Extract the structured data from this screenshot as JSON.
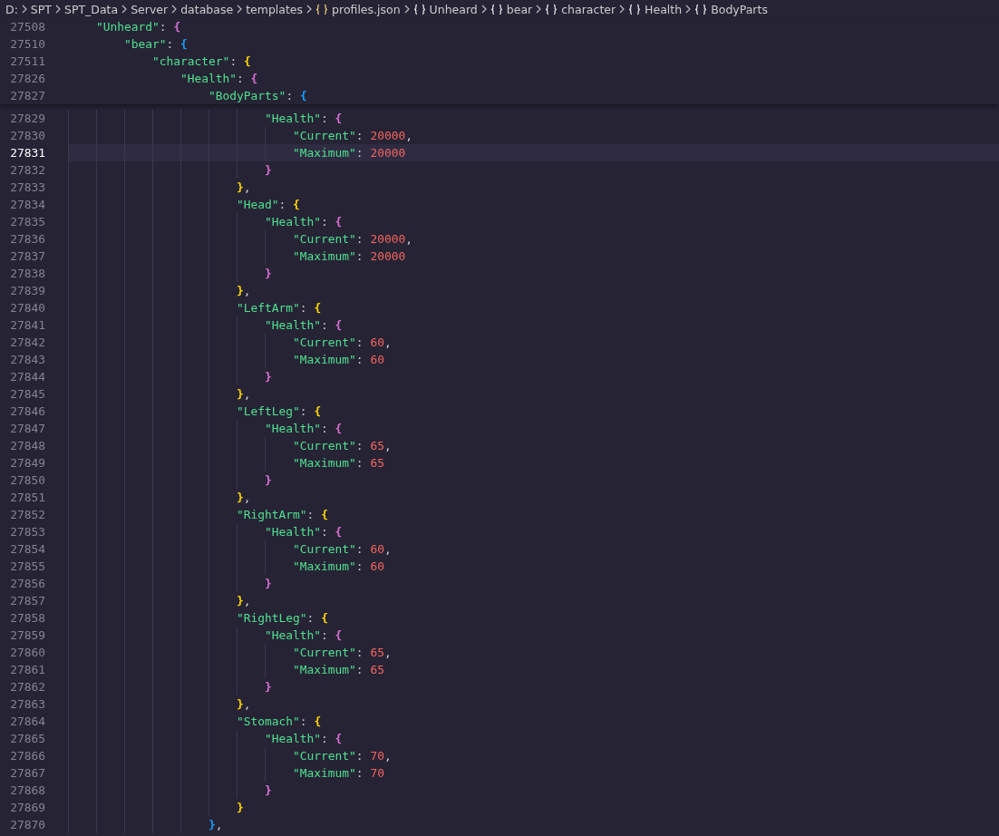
{
  "breadcrumbs": [
    {
      "label": "D:",
      "kind": "folder"
    },
    {
      "label": "SPT",
      "kind": "folder"
    },
    {
      "label": "SPT_Data",
      "kind": "folder"
    },
    {
      "label": "Server",
      "kind": "folder"
    },
    {
      "label": "database",
      "kind": "folder"
    },
    {
      "label": "templates",
      "kind": "folder"
    },
    {
      "label": "profiles.json",
      "kind": "json-file"
    },
    {
      "label": "Unheard",
      "kind": "object"
    },
    {
      "label": "bear",
      "kind": "object"
    },
    {
      "label": "character",
      "kind": "object"
    },
    {
      "label": "Health",
      "kind": "object"
    },
    {
      "label": "BodyParts",
      "kind": "object"
    }
  ],
  "sticky_scroll": [
    {
      "number": "27508",
      "tokens": [
        {
          "kind": "key",
          "text": "\"Unheard\""
        },
        {
          "kind": "punct",
          "text": ":"
        },
        {
          "kind": "bracket",
          "text": "{",
          "color": "#da70d6"
        }
      ],
      "children": [
        {
          "number": "27510",
          "tokens": [
            {
              "kind": "key",
              "text": "\"bear\""
            },
            {
              "kind": "punct",
              "text": ":"
            },
            {
              "kind": "bracket",
              "text": "{",
              "color": "#179fff"
            }
          ],
          "children": [
            {
              "number": "27511",
              "tokens": [
                {
                  "kind": "key",
                  "text": "\"character\""
                },
                {
                  "kind": "punct",
                  "text": ":"
                },
                {
                  "kind": "bracket",
                  "text": "{",
                  "color": "#ffd700"
                }
              ],
              "children": [
                {
                  "number": "27826",
                  "tokens": [
                    {
                      "kind": "key",
                      "text": "\"Health\""
                    },
                    {
                      "kind": "punct",
                      "text": ":"
                    },
                    {
                      "kind": "bracket",
                      "text": "{",
                      "color": "#da70d6"
                    }
                  ],
                  "children": [
                    {
                      "number": "27827",
                      "tokens": [
                        {
                          "kind": "key",
                          "text": "\"BodyParts\""
                        },
                        {
                          "kind": "punct",
                          "text": ":"
                        },
                        {
                          "kind": "bracket",
                          "text": "{",
                          "color": "#179fff"
                        }
                      ]
                    }
                  ]
                }
              ]
            }
          ]
        }
      ]
    }
  ],
  "lines": [
    {
      "children": [
        {
          "children": [
            {
              "number": "27829",
              "current": false,
              "tokens": [
                {
                  "kind": "key",
                  "text": "\"Health\""
                },
                {
                  "kind": "punct",
                  "text": ":"
                },
                {
                  "kind": "bracket",
                  "text": "{",
                  "color": "#da70d6"
                }
              ],
              "children": [
                {
                  "number": "27830",
                  "current": false,
                  "tokens": [
                    {
                      "kind": "key",
                      "text": "\"Current\""
                    },
                    {
                      "kind": "punct",
                      "text": ":"
                    },
                    {
                      "kind": "number",
                      "text": "20000"
                    },
                    {
                      "kind": "comma",
                      "text": ","
                    }
                  ]
                },
                {
                  "number": "27831",
                  "current": true,
                  "tokens": [
                    {
                      "kind": "key",
                      "text": "\"Maximum\""
                    },
                    {
                      "kind": "punct",
                      "text": ":"
                    },
                    {
                      "kind": "number",
                      "text": "20000"
                    }
                  ]
                }
              ]
            },
            {
              "number": "27832",
              "current": false,
              "tokens": [
                {
                  "kind": "bracket",
                  "text": "}",
                  "color": "#da70d6"
                }
              ]
            }
          ]
        },
        {
          "number": "27833",
          "current": false,
          "tokens": [
            {
              "kind": "bracket",
              "text": "}",
              "color": "#ffd700"
            },
            {
              "kind": "comma",
              "text": ","
            }
          ]
        },
        {
          "number": "27834",
          "current": false,
          "tokens": [
            {
              "kind": "key",
              "text": "\"Head\""
            },
            {
              "kind": "punct",
              "text": ":"
            },
            {
              "kind": "bracket",
              "text": "{",
              "color": "#ffd700"
            }
          ],
          "children": [
            {
              "number": "27835",
              "current": false,
              "tokens": [
                {
                  "kind": "key",
                  "text": "\"Health\""
                },
                {
                  "kind": "punct",
                  "text": ":"
                },
                {
                  "kind": "bracket",
                  "text": "{",
                  "color": "#da70d6"
                }
              ],
              "children": [
                {
                  "number": "27836",
                  "current": false,
                  "tokens": [
                    {
                      "kind": "key",
                      "text": "\"Current\""
                    },
                    {
                      "kind": "punct",
                      "text": ":"
                    },
                    {
                      "kind": "number",
                      "text": "20000"
                    },
                    {
                      "kind": "comma",
                      "text": ","
                    }
                  ]
                },
                {
                  "number": "27837",
                  "current": false,
                  "tokens": [
                    {
                      "kind": "key",
                      "text": "\"Maximum\""
                    },
                    {
                      "kind": "punct",
                      "text": ":"
                    },
                    {
                      "kind": "number",
                      "text": "20000"
                    }
                  ]
                }
              ]
            },
            {
              "number": "27838",
              "current": false,
              "tokens": [
                {
                  "kind": "bracket",
                  "text": "}",
                  "color": "#da70d6"
                }
              ]
            }
          ]
        },
        {
          "number": "27839",
          "current": false,
          "tokens": [
            {
              "kind": "bracket",
              "text": "}",
              "color": "#ffd700"
            },
            {
              "kind": "comma",
              "text": ","
            }
          ]
        },
        {
          "number": "27840",
          "current": false,
          "tokens": [
            {
              "kind": "key",
              "text": "\"LeftArm\""
            },
            {
              "kind": "punct",
              "text": ":"
            },
            {
              "kind": "bracket",
              "text": "{",
              "color": "#ffd700"
            }
          ],
          "children": [
            {
              "number": "27841",
              "current": false,
              "tokens": [
                {
                  "kind": "key",
                  "text": "\"Health\""
                },
                {
                  "kind": "punct",
                  "text": ":"
                },
                {
                  "kind": "bracket",
                  "text": "{",
                  "color": "#da70d6"
                }
              ],
              "children": [
                {
                  "number": "27842",
                  "current": false,
                  "tokens": [
                    {
                      "kind": "key",
                      "text": "\"Current\""
                    },
                    {
                      "kind": "punct",
                      "text": ":"
                    },
                    {
                      "kind": "number",
                      "text": "60"
                    },
                    {
                      "kind": "comma",
                      "text": ","
                    }
                  ]
                },
                {
                  "number": "27843",
                  "current": false,
                  "tokens": [
                    {
                      "kind": "key",
                      "text": "\"Maximum\""
                    },
                    {
                      "kind": "punct",
                      "text": ":"
                    },
                    {
                      "kind": "number",
                      "text": "60"
                    }
                  ]
                }
              ]
            },
            {
              "number": "27844",
              "current": false,
              "tokens": [
                {
                  "kind": "bracket",
                  "text": "}",
                  "color": "#da70d6"
                }
              ]
            }
          ]
        },
        {
          "number": "27845",
          "current": false,
          "tokens": [
            {
              "kind": "bracket",
              "text": "}",
              "color": "#ffd700"
            },
            {
              "kind": "comma",
              "text": ","
            }
          ]
        },
        {
          "number": "27846",
          "current": false,
          "tokens": [
            {
              "kind": "key",
              "text": "\"LeftLeg\""
            },
            {
              "kind": "punct",
              "text": ":"
            },
            {
              "kind": "bracket",
              "text": "{",
              "color": "#ffd700"
            }
          ],
          "children": [
            {
              "number": "27847",
              "current": false,
              "tokens": [
                {
                  "kind": "key",
                  "text": "\"Health\""
                },
                {
                  "kind": "punct",
                  "text": ":"
                },
                {
                  "kind": "bracket",
                  "text": "{",
                  "color": "#da70d6"
                }
              ],
              "children": [
                {
                  "number": "27848",
                  "current": false,
                  "tokens": [
                    {
                      "kind": "key",
                      "text": "\"Current\""
                    },
                    {
                      "kind": "punct",
                      "text": ":"
                    },
                    {
                      "kind": "number",
                      "text": "65"
                    },
                    {
                      "kind": "comma",
                      "text": ","
                    }
                  ]
                },
                {
                  "number": "27849",
                  "current": false,
                  "tokens": [
                    {
                      "kind": "key",
                      "text": "\"Maximum\""
                    },
                    {
                      "kind": "punct",
                      "text": ":"
                    },
                    {
                      "kind": "number",
                      "text": "65"
                    }
                  ]
                }
              ]
            },
            {
              "number": "27850",
              "current": false,
              "tokens": [
                {
                  "kind": "bracket",
                  "text": "}",
                  "color": "#da70d6"
                }
              ]
            }
          ]
        },
        {
          "number": "27851",
          "current": false,
          "tokens": [
            {
              "kind": "bracket",
              "text": "}",
              "color": "#ffd700"
            },
            {
              "kind": "comma",
              "text": ","
            }
          ]
        },
        {
          "number": "27852",
          "current": false,
          "tokens": [
            {
              "kind": "key",
              "text": "\"RightArm\""
            },
            {
              "kind": "punct",
              "text": ":"
            },
            {
              "kind": "bracket",
              "text": "{",
              "color": "#ffd700"
            }
          ],
          "children": [
            {
              "number": "27853",
              "current": false,
              "tokens": [
                {
                  "kind": "key",
                  "text": "\"Health\""
                },
                {
                  "kind": "punct",
                  "text": ":"
                },
                {
                  "kind": "bracket",
                  "text": "{",
                  "color": "#da70d6"
                }
              ],
              "children": [
                {
                  "number": "27854",
                  "current": false,
                  "tokens": [
                    {
                      "kind": "key",
                      "text": "\"Current\""
                    },
                    {
                      "kind": "punct",
                      "text": ":"
                    },
                    {
                      "kind": "number",
                      "text": "60"
                    },
                    {
                      "kind": "comma",
                      "text": ","
                    }
                  ]
                },
                {
                  "number": "27855",
                  "current": false,
                  "tokens": [
                    {
                      "kind": "key",
                      "text": "\"Maximum\""
                    },
                    {
                      "kind": "punct",
                      "text": ":"
                    },
                    {
                      "kind": "number",
                      "text": "60"
                    }
                  ]
                }
              ]
            },
            {
              "number": "27856",
              "current": false,
              "tokens": [
                {
                  "kind": "bracket",
                  "text": "}",
                  "color": "#da70d6"
                }
              ]
            }
          ]
        },
        {
          "number": "27857",
          "current": false,
          "tokens": [
            {
              "kind": "bracket",
              "text": "}",
              "color": "#ffd700"
            },
            {
              "kind": "comma",
              "text": ","
            }
          ]
        },
        {
          "number": "27858",
          "current": false,
          "tokens": [
            {
              "kind": "key",
              "text": "\"RightLeg\""
            },
            {
              "kind": "punct",
              "text": ":"
            },
            {
              "kind": "bracket",
              "text": "{",
              "color": "#ffd700"
            }
          ],
          "children": [
            {
              "number": "27859",
              "current": false,
              "tokens": [
                {
                  "kind": "key",
                  "text": "\"Health\""
                },
                {
                  "kind": "punct",
                  "text": ":"
                },
                {
                  "kind": "bracket",
                  "text": "{",
                  "color": "#da70d6"
                }
              ],
              "children": [
                {
                  "number": "27860",
                  "current": false,
                  "tokens": [
                    {
                      "kind": "key",
                      "text": "\"Current\""
                    },
                    {
                      "kind": "punct",
                      "text": ":"
                    },
                    {
                      "kind": "number",
                      "text": "65"
                    },
                    {
                      "kind": "comma",
                      "text": ","
                    }
                  ]
                },
                {
                  "number": "27861",
                  "current": false,
                  "tokens": [
                    {
                      "kind": "key",
                      "text": "\"Maximum\""
                    },
                    {
                      "kind": "punct",
                      "text": ":"
                    },
                    {
                      "kind": "number",
                      "text": "65"
                    }
                  ]
                }
              ]
            },
            {
              "number": "27862",
              "current": false,
              "tokens": [
                {
                  "kind": "bracket",
                  "text": "}",
                  "color": "#da70d6"
                }
              ]
            }
          ]
        },
        {
          "number": "27863",
          "current": false,
          "tokens": [
            {
              "kind": "bracket",
              "text": "}",
              "color": "#ffd700"
            },
            {
              "kind": "comma",
              "text": ","
            }
          ]
        },
        {
          "number": "27864",
          "current": false,
          "tokens": [
            {
              "kind": "key",
              "text": "\"Stomach\""
            },
            {
              "kind": "punct",
              "text": ":"
            },
            {
              "kind": "bracket",
              "text": "{",
              "color": "#ffd700"
            }
          ],
          "children": [
            {
              "number": "27865",
              "current": false,
              "tokens": [
                {
                  "kind": "key",
                  "text": "\"Health\""
                },
                {
                  "kind": "punct",
                  "text": ":"
                },
                {
                  "kind": "bracket",
                  "text": "{",
                  "color": "#da70d6"
                }
              ],
              "children": [
                {
                  "number": "27866",
                  "current": false,
                  "tokens": [
                    {
                      "kind": "key",
                      "text": "\"Current\""
                    },
                    {
                      "kind": "punct",
                      "text": ":"
                    },
                    {
                      "kind": "number",
                      "text": "70"
                    },
                    {
                      "kind": "comma",
                      "text": ","
                    }
                  ]
                },
                {
                  "number": "27867",
                  "current": false,
                  "tokens": [
                    {
                      "kind": "key",
                      "text": "\"Maximum\""
                    },
                    {
                      "kind": "punct",
                      "text": ":"
                    },
                    {
                      "kind": "number",
                      "text": "70"
                    }
                  ]
                }
              ]
            },
            {
              "number": "27868",
              "current": false,
              "tokens": [
                {
                  "kind": "bracket",
                  "text": "}",
                  "color": "#da70d6"
                }
              ]
            }
          ]
        },
        {
          "number": "27869",
          "current": false,
          "tokens": [
            {
              "kind": "bracket",
              "text": "}",
              "color": "#ffd700"
            }
          ]
        }
      ]
    },
    {
      "number": "27870",
      "current": false,
      "tokens": [
        {
          "kind": "bracket",
          "text": "}",
          "color": "#179fff"
        },
        {
          "kind": "comma",
          "text": ","
        }
      ]
    }
  ]
}
